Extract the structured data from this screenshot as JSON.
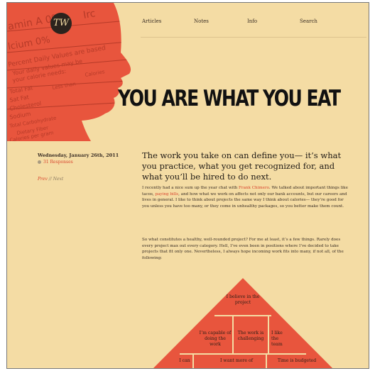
{
  "nav": {
    "articles": "Articles",
    "notes": "Notes",
    "info": "Info",
    "search": "Search"
  },
  "logo": {
    "text": "TW"
  },
  "headline": "YOU ARE WHAT YOU EAT",
  "post": {
    "date": "Wednesday, January 26th, 2011",
    "responses": "31 Responses",
    "prev": "Prev",
    "separator": "//",
    "next": "Next"
  },
  "article": {
    "subhead": "The work you take on can define you— it’s what you practice, what you get recognized for, and what you’ll be hired to do next.",
    "p1_a": "I recently had a nice sum up the year chat with ",
    "p1_link1": "Frank Chimero",
    "p1_b": ". We talked about important things like tacos, ",
    "p1_link2": "paying bills",
    "p1_c": ", and how what we work on affects not only our bank accounts, but our careers and lives in general. I like to think about projects the same way I think about calories— they’re good for you unless you have too many, or they come in unhealthy packages, so you better make them count.",
    "p2": "So what constitutes a healthy, well-rounded project? For me at least, it’s a few things. Rarely does every project max out every category. Hell, I’ve even been in positions where I’ve decided to take projects that fit only one. Nevertheless, I always hope incoming work fits into many, if not all, of the following:"
  },
  "pyramid": {
    "top": "I believe in the project",
    "mid_left": "I’m capable of doing the work",
    "mid_center": "The work is challenging",
    "mid_right": "I like the team",
    "bot_left": "I can",
    "bot_center": "I want more of",
    "bot_right": "Time is budgeted"
  },
  "head_text": {
    "l1": "amin A 0%",
    "l2": "Irc",
    "l3": "lcium 0%",
    "l4": "Percent Daily Values are based",
    "l5": "Your daily values may be",
    "l6": "your calorie needs:",
    "l7": "Calories",
    "l8": "Total Fat",
    "l9": "Less than",
    "l10": "Sat Fat",
    "l11": "Cholesterol",
    "l12": "Sodium",
    "l13": "Total Carbohydrate",
    "l14": "Dietary Fiber",
    "l15": "Calories per gram"
  },
  "colors": {
    "background": "#f4dca4",
    "accent": "#e8553d",
    "ink": "#111111",
    "link": "#d8452e"
  }
}
